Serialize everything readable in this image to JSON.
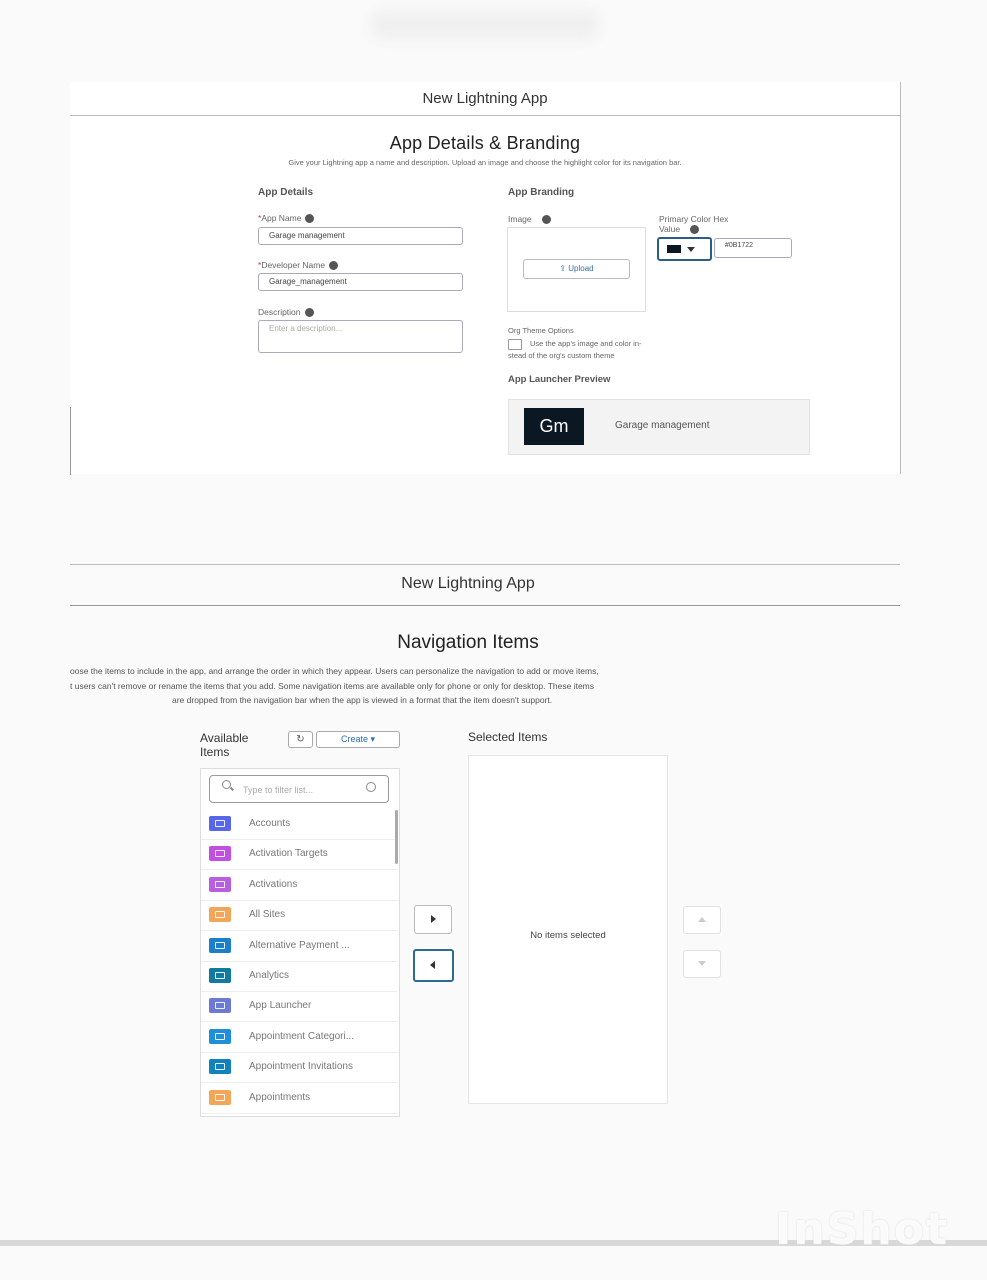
{
  "screen1": {
    "modal_title": "New Lightning App",
    "page_title": "App Details & Branding",
    "subtitle": "Give your Lightning app a name and description. Upload an image and choose the highlight color for its navigation bar.",
    "app_details": {
      "section_title": "App Details",
      "app_name_label": "App Name",
      "app_name_value": "Garage management",
      "developer_name_label": "Developer Name",
      "developer_name_value": "Garage_management",
      "description_label": "Description",
      "description_placeholder": "Enter a description..."
    },
    "app_branding": {
      "section_title": "App Branding",
      "image_label": "Image",
      "upload_label": "Upload",
      "primary_color_label_1": "Primary Color Hex",
      "primary_color_label_2": "Value",
      "primary_color_value": "#0B1722",
      "org_theme_title": "Org Theme Options",
      "org_theme_line1": "Use the app's image and color in-",
      "org_theme_line2": "stead of the org's custom theme",
      "launcher_preview_title": "App Launcher Preview",
      "launcher_initials": "Gm",
      "launcher_name": "Garage management"
    }
  },
  "screen2": {
    "modal_title": "New Lightning App",
    "page_title": "Navigation Items",
    "desc_line1": "oose the items to include in the app, and arrange the order in which they appear. Users can personalize the navigation to add or move items,",
    "desc_line2": "t users can't remove or rename the items that you add. Some navigation items are available only for phone or only for desktop. These items",
    "desc_line3": "are dropped from the navigation bar when the app is viewed in a format that the item doesn't support.",
    "available_label_1": "Available",
    "available_label_2": "Items",
    "create_label": "Create",
    "search_placeholder": "Type to filter list...",
    "selected_label": "Selected Items",
    "no_items_text": "No items selected",
    "items": [
      {
        "label": "Accounts",
        "color": "#5867e8"
      },
      {
        "label": "Activation Targets",
        "color": "#c24fe0"
      },
      {
        "label": "Activations",
        "color": "#b85ee0"
      },
      {
        "label": "All Sites",
        "color": "#f2a65a"
      },
      {
        "label": "Alternative Payment ...",
        "color": "#1b7fc9"
      },
      {
        "label": "Analytics",
        "color": "#117a9e"
      },
      {
        "label": "App Launcher",
        "color": "#6c7ad6"
      },
      {
        "label": "Appointment Categori...",
        "color": "#1f8fd8"
      },
      {
        "label": "Appointment Invitations",
        "color": "#1282bd"
      },
      {
        "label": "Appointments",
        "color": "#f2a65a"
      }
    ]
  },
  "watermark": "InShot"
}
